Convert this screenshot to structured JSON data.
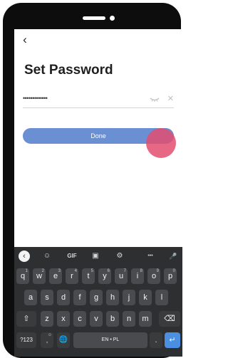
{
  "page": {
    "title": "Set Password",
    "back_icon": "back-arrow-icon"
  },
  "password": {
    "value": "•••••••••••••",
    "eye_icon": "eye-hidden-icon",
    "clear_icon": "clear-icon"
  },
  "done_button": {
    "label": "Done"
  },
  "keyboard": {
    "toolbar": {
      "back": "‹",
      "sticker": "☺",
      "gif": "GIF",
      "clipboard": "▣",
      "settings": "⚙",
      "more": "•••",
      "mic": "🎤"
    },
    "row1": [
      {
        "k": "q",
        "sup": "1"
      },
      {
        "k": "w",
        "sup": "2"
      },
      {
        "k": "e",
        "sup": "3"
      },
      {
        "k": "r",
        "sup": "4"
      },
      {
        "k": "t",
        "sup": "5"
      },
      {
        "k": "y",
        "sup": "6"
      },
      {
        "k": "u",
        "sup": "7"
      },
      {
        "k": "i",
        "sup": "8"
      },
      {
        "k": "o",
        "sup": "9"
      },
      {
        "k": "p",
        "sup": "0"
      }
    ],
    "row2": [
      "a",
      "s",
      "d",
      "f",
      "g",
      "h",
      "j",
      "k",
      "l"
    ],
    "row3": [
      "z",
      "x",
      "c",
      "v",
      "b",
      "n",
      "m"
    ],
    "shift": "⇧",
    "backspace": "⌫",
    "symbols": "?123",
    "comma": ",",
    "emoji": "☺",
    "globe": "🌐",
    "space": "EN • PL",
    "period": ".",
    "enter": "↵"
  },
  "colors": {
    "done_button": "#6a8fd3",
    "touch_indicator": "#e24e70",
    "keyboard_bg": "#2e2f31",
    "key_bg": "#4a4b4e",
    "enter": "#4a8fe0"
  }
}
